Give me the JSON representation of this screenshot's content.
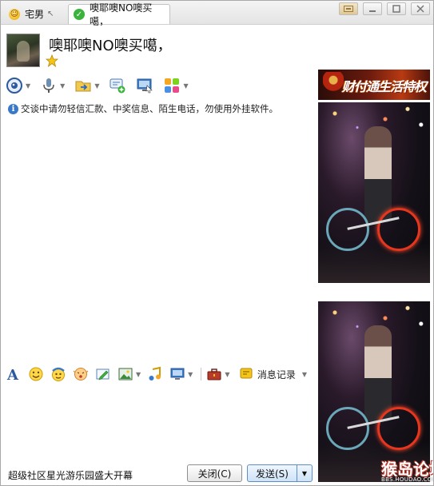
{
  "tabs": [
    {
      "label": "宅男",
      "icon": "smiley-icon",
      "typing": "↖"
    },
    {
      "label": "噢耶噢NO噢买噶，",
      "icon": "online-check-icon"
    }
  ],
  "window_buttons": [
    "skin",
    "minimize",
    "maximize",
    "close"
  ],
  "contact": {
    "name": "噢耶噢NO噢买噶，",
    "badge_icon": "star-level-icon"
  },
  "toolbar": {
    "items": [
      {
        "name": "video-call",
        "icon": "camera-icon"
      },
      {
        "name": "voice-call",
        "icon": "microphone-icon"
      },
      {
        "name": "send-file",
        "icon": "folder-icon"
      },
      {
        "name": "new-discussion",
        "icon": "chat-add-icon"
      },
      {
        "name": "remote-assist",
        "icon": "remote-desktop-icon"
      },
      {
        "name": "apps",
        "icon": "apps-grid-icon"
      }
    ]
  },
  "notice": "交谈中请勿轻信汇款、中奖信息、陌生电话，勿使用外挂软件。",
  "format_toolbar": {
    "history_label": "消息记录"
  },
  "bottom": {
    "ad_text": "超级社区星光游乐园盛大开幕",
    "close_label": "关闭(C)",
    "send_label": "发送(S)"
  },
  "banner": {
    "text": "财付通生活特权"
  },
  "watermark": {
    "text": "猴岛论坛",
    "sub": "BBS.HOUDAO.COM"
  }
}
